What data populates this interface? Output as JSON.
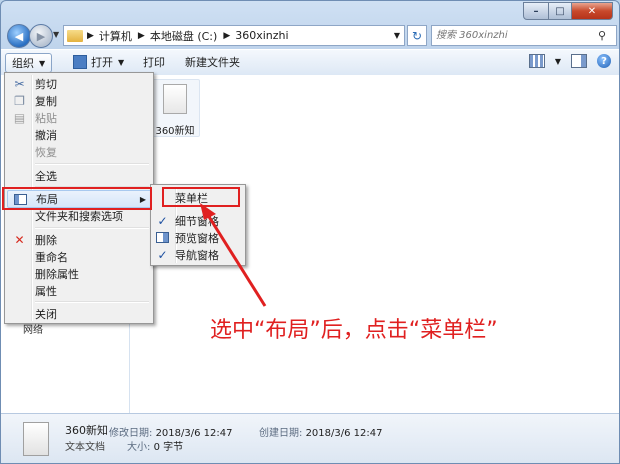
{
  "window": {
    "controls": {
      "minimize": "–",
      "maximize": "□",
      "close": "✕"
    }
  },
  "address": {
    "crumbs": [
      "计算机",
      "本地磁盘 (C:)",
      "360xinzhi"
    ],
    "search_placeholder": "搜索 360xinzhi"
  },
  "toolbar": {
    "organize": "组织",
    "open": "打开",
    "print": "打印",
    "new_folder": "新建文件夹"
  },
  "file": {
    "name": "360新知"
  },
  "nav_stub": "网络",
  "menu": {
    "cut": "剪切",
    "copy": "复制",
    "paste": "粘贴",
    "undo": "撤消",
    "redo": "恢复",
    "select_all": "全选",
    "layout": "布局",
    "folder_options": "文件夹和搜索选项",
    "delete": "删除",
    "rename": "重命名",
    "remove_properties": "删除属性",
    "properties": "属性",
    "close": "关闭"
  },
  "submenu": {
    "menu_bar": "菜单栏",
    "details_pane": "细节窗格",
    "preview_pane": "预览窗格",
    "navigation_pane": "导航窗格"
  },
  "annotation": "选中“布局”后，点击“菜单栏”",
  "details": {
    "name": "360新知",
    "type": "文本文档",
    "modified_label": "修改日期:",
    "modified": "2018/3/6 12:47",
    "size_label": "大小:",
    "size": "0 字节",
    "created_label": "创建日期:",
    "created": "2018/3/6 12:47"
  },
  "colors": {
    "annotation_red": "#e02020",
    "accent_blue": "#2a6fc2"
  }
}
